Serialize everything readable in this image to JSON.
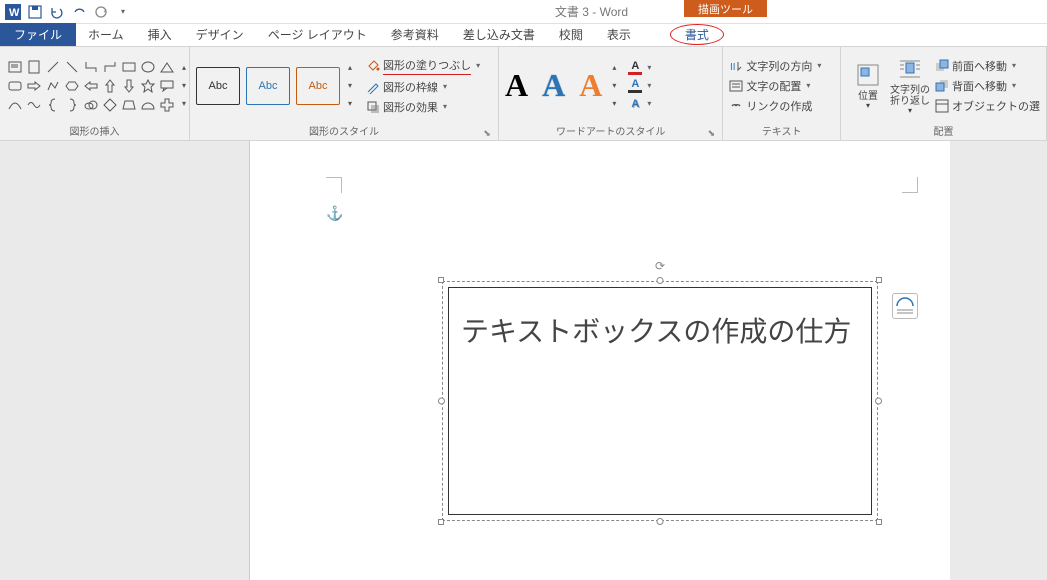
{
  "title": "文書 3 - Word",
  "contextual_tab": "描画ツール",
  "tabs": {
    "file": "ファイル",
    "home": "ホーム",
    "insert": "挿入",
    "design": "デザイン",
    "layout": "ページ レイアウト",
    "references": "参考資料",
    "mailings": "差し込み文書",
    "review": "校閲",
    "view": "表示",
    "format": "書式"
  },
  "groups": {
    "insert_shapes": "図形の挿入",
    "shape_styles": "図形のスタイル",
    "wordart_styles": "ワードアートのスタイル",
    "text": "テキスト",
    "arrange": "配置"
  },
  "shape_style_label": "Abc",
  "shape_cmds": {
    "fill": "図形の塗りつぶし",
    "outline": "図形の枠線",
    "effects": "図形の効果"
  },
  "wordart_letter": "A",
  "text_cmds": {
    "direction": "文字列の方向",
    "align": "文字の配置",
    "link": "リンクの作成"
  },
  "position": "位置",
  "wrap": "文字列の\n折り返し",
  "arrange_cmds": {
    "front": "前面へ移動",
    "back": "背面へ移動",
    "select": "オブジェクトの選"
  },
  "textbox_content": "テキストボックスの作成の仕方"
}
